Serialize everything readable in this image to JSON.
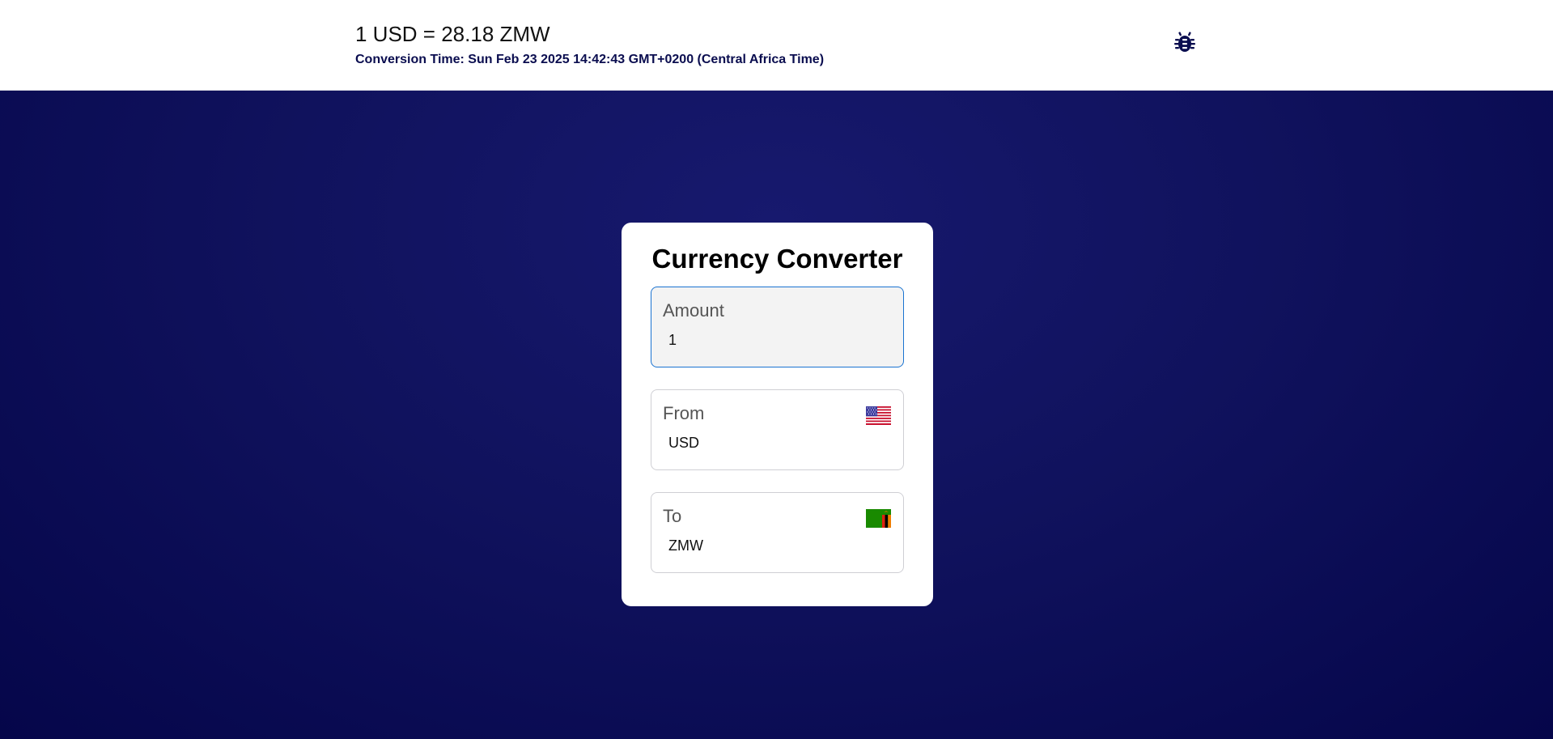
{
  "header": {
    "rate_text": "1 USD = 28.18 ZMW",
    "conversion_time": "Conversion Time: Sun Feb 23 2025 14:42:43 GMT+0200 (Central Africa Time)",
    "debug_icon": "bug-icon"
  },
  "converter": {
    "title": "Currency Converter",
    "amount": {
      "label": "Amount",
      "value": "1"
    },
    "from": {
      "label": "From",
      "value": "USD",
      "flag": "us-flag-icon"
    },
    "to": {
      "label": "To",
      "value": "ZMW",
      "flag": "zambia-flag-icon"
    }
  },
  "colors": {
    "background": "#10125d",
    "header_text": "#0a0d4f",
    "focus_border": "#1a73d1"
  }
}
